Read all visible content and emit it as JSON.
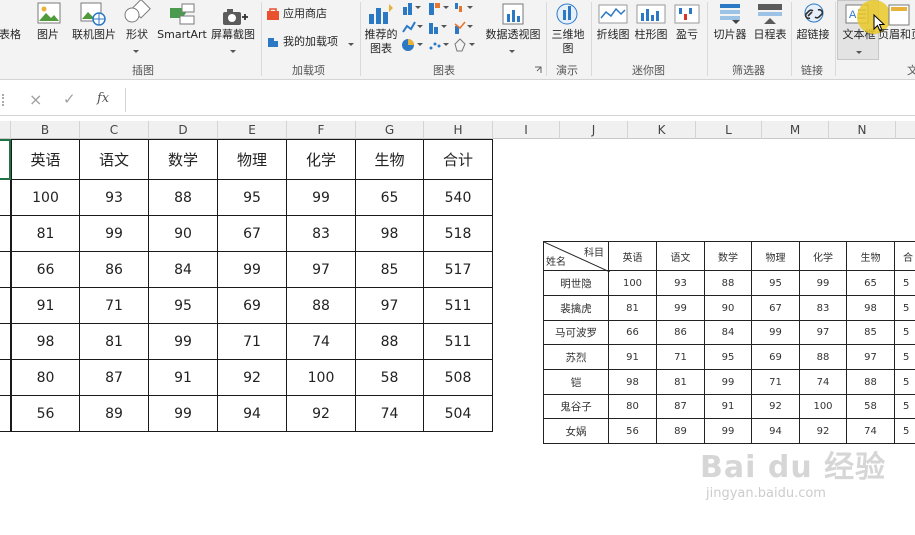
{
  "ribbon": {
    "groups": [
      {
        "label": "插图"
      },
      {
        "label": "加载项"
      },
      {
        "label": "图表"
      },
      {
        "label": "演示"
      },
      {
        "label": "迷你图"
      },
      {
        "label": "筛选器"
      },
      {
        "label": "链接"
      },
      {
        "label": "文"
      }
    ],
    "buttons": {
      "table_partial": "表格",
      "pictures": "图片",
      "online_pictures": "联机图片",
      "shapes": "形状",
      "smartart": "SmartArt",
      "screenshot": "屏幕截图",
      "app_store": "应用商店",
      "my_addins": "我的加载项",
      "recommended_charts_1": "推荐的",
      "recommended_charts_2": "图表",
      "pivot_chart": "数据透视图",
      "map3d_1": "三维地",
      "map3d_2": "图",
      "sparkline_line": "折线图",
      "sparkline_column": "柱形图",
      "sparkline_winloss": "盈亏",
      "slicer": "切片器",
      "timeline": "日程表",
      "hyperlink": "超链接",
      "textbox": "文本框",
      "header_footer": "页眉和页"
    }
  },
  "formula_bar": {
    "cancel_icon": "×",
    "enter_icon": "✓",
    "fx_label": "fx",
    "value": ""
  },
  "columns": [
    "B",
    "C",
    "D",
    "E",
    "F",
    "G",
    "H",
    "I",
    "J",
    "K",
    "L",
    "M",
    "N"
  ],
  "big_table": {
    "headers": [
      "英语",
      "语文",
      "数学",
      "物理",
      "化学",
      "生物",
      "合计"
    ],
    "rows": [
      [
        "100",
        "93",
        "88",
        "95",
        "99",
        "65",
        "540"
      ],
      [
        "81",
        "99",
        "90",
        "67",
        "83",
        "98",
        "518"
      ],
      [
        "66",
        "86",
        "84",
        "99",
        "97",
        "85",
        "517"
      ],
      [
        "91",
        "71",
        "95",
        "69",
        "88",
        "97",
        "511"
      ],
      [
        "98",
        "81",
        "99",
        "71",
        "74",
        "88",
        "511"
      ],
      [
        "80",
        "87",
        "91",
        "92",
        "100",
        "58",
        "508"
      ],
      [
        "56",
        "89",
        "99",
        "94",
        "92",
        "74",
        "504"
      ]
    ]
  },
  "small_table": {
    "corner_top": "科目",
    "corner_bottom": "姓名",
    "headers": [
      "英语",
      "语文",
      "数学",
      "物理",
      "化学",
      "生物",
      "合"
    ],
    "rows": [
      {
        "name": "明世隐",
        "values": [
          "100",
          "93",
          "88",
          "95",
          "99",
          "65",
          "5"
        ]
      },
      {
        "name": "裴擒虎",
        "values": [
          "81",
          "99",
          "90",
          "67",
          "83",
          "98",
          "5"
        ]
      },
      {
        "name": "马可波罗",
        "values": [
          "66",
          "86",
          "84",
          "99",
          "97",
          "85",
          "5"
        ]
      },
      {
        "name": "苏烈",
        "values": [
          "91",
          "71",
          "95",
          "69",
          "88",
          "97",
          "5"
        ]
      },
      {
        "name": "铠",
        "values": [
          "98",
          "81",
          "99",
          "71",
          "74",
          "88",
          "5"
        ]
      },
      {
        "name": "鬼谷子",
        "values": [
          "80",
          "87",
          "91",
          "92",
          "100",
          "58",
          "5"
        ]
      },
      {
        "name": "女娲",
        "values": [
          "56",
          "89",
          "99",
          "94",
          "92",
          "74",
          "5"
        ]
      }
    ]
  },
  "watermark": {
    "brand": "Bai du 经验",
    "url": "jingyan.baidu.com"
  },
  "colors": {
    "ribbon_bg": "#f3f3f3",
    "accent_blue": "#2b78c5",
    "accent_orange": "#e8772e"
  }
}
